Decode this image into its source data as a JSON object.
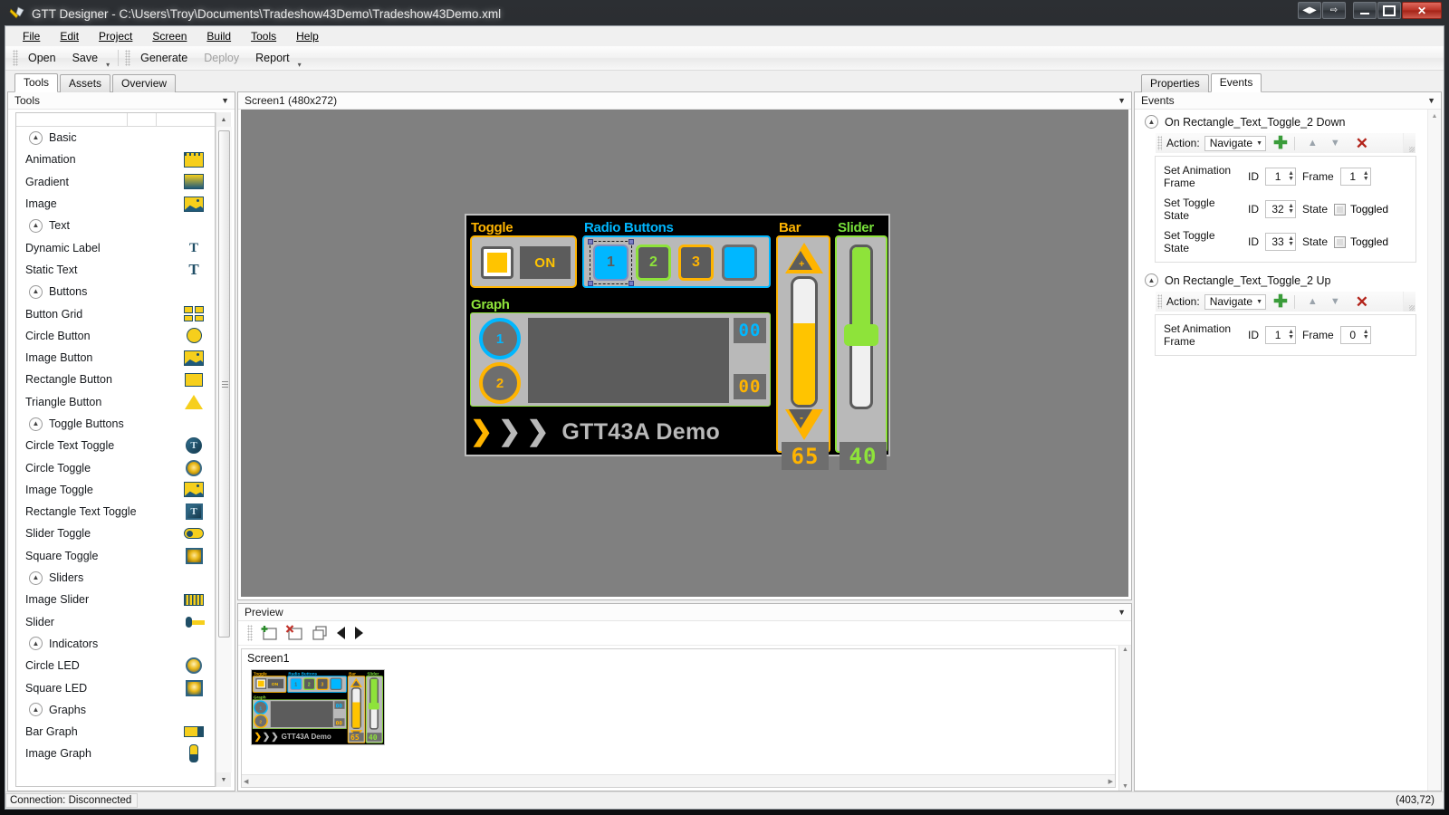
{
  "window": {
    "title": "GTT Designer - C:\\Users\\Troy\\Documents\\Tradeshow43Demo\\Tradeshow43Demo.xml",
    "buttons": {
      "expand": "◀▶",
      "restore_down": "⇨",
      "minimize": "—",
      "maximize": "❐",
      "close": "✕"
    }
  },
  "menu": [
    "File",
    "Edit",
    "Project",
    "Screen",
    "Build",
    "Tools",
    "Help"
  ],
  "toolbar": {
    "group1": [
      "Open",
      "Save"
    ],
    "group2": [
      "Generate",
      "Deploy",
      "Report"
    ],
    "disabled": [
      "Deploy"
    ]
  },
  "left": {
    "tabs": [
      {
        "label": "Tools",
        "active": true
      },
      {
        "label": "Assets",
        "active": false
      },
      {
        "label": "Overview",
        "active": false
      }
    ],
    "panel_title": "Tools",
    "items": [
      {
        "label": "Basic",
        "type": "group",
        "icon": "collapse-chevron-icon"
      },
      {
        "label": "Animation",
        "type": "item",
        "icon": "animation-icon"
      },
      {
        "label": "Gradient",
        "type": "item",
        "icon": "gradient-icon"
      },
      {
        "label": "Image",
        "type": "item",
        "icon": "image-icon"
      },
      {
        "label": "Text",
        "type": "group",
        "icon": "collapse-chevron-icon"
      },
      {
        "label": "Dynamic Label",
        "type": "item",
        "icon": "dynamic-label-icon"
      },
      {
        "label": "Static Text",
        "type": "item",
        "icon": "static-text-icon"
      },
      {
        "label": "Buttons",
        "type": "group",
        "icon": "collapse-chevron-icon"
      },
      {
        "label": "Button Grid",
        "type": "item",
        "icon": "button-grid-icon"
      },
      {
        "label": "Circle Button",
        "type": "item",
        "icon": "circle-button-icon"
      },
      {
        "label": "Image Button",
        "type": "item",
        "icon": "image-button-icon"
      },
      {
        "label": "Rectangle Button",
        "type": "item",
        "icon": "rectangle-button-icon"
      },
      {
        "label": "Triangle Button",
        "type": "item",
        "icon": "triangle-button-icon"
      },
      {
        "label": "Toggle Buttons",
        "type": "group",
        "icon": "collapse-chevron-icon"
      },
      {
        "label": "Circle Text Toggle",
        "type": "item",
        "icon": "circle-text-toggle-icon"
      },
      {
        "label": "Circle Toggle",
        "type": "item",
        "icon": "circle-toggle-icon"
      },
      {
        "label": "Image Toggle",
        "type": "item",
        "icon": "image-toggle-icon"
      },
      {
        "label": "Rectangle Text Toggle",
        "type": "item",
        "icon": "rectangle-text-toggle-icon"
      },
      {
        "label": "Slider Toggle",
        "type": "item",
        "icon": "slider-toggle-icon"
      },
      {
        "label": "Square Toggle",
        "type": "item",
        "icon": "square-toggle-icon"
      },
      {
        "label": "Sliders",
        "type": "group",
        "icon": "collapse-chevron-icon"
      },
      {
        "label": "Image Slider",
        "type": "item",
        "icon": "image-slider-icon"
      },
      {
        "label": "Slider",
        "type": "item",
        "icon": "slider-icon"
      },
      {
        "label": "Indicators",
        "type": "group",
        "icon": "collapse-chevron-icon"
      },
      {
        "label": "Circle LED",
        "type": "item",
        "icon": "circle-led-icon"
      },
      {
        "label": "Square LED",
        "type": "item",
        "icon": "square-led-icon"
      },
      {
        "label": "Graphs",
        "type": "group",
        "icon": "collapse-chevron-icon"
      },
      {
        "label": "Bar Graph",
        "type": "item",
        "icon": "bar-graph-icon"
      },
      {
        "label": "Image Graph",
        "type": "item",
        "icon": "image-graph-icon"
      }
    ]
  },
  "canvas": {
    "title": "Screen1 (480x272)",
    "screen": {
      "labels": {
        "toggle": "Toggle",
        "radio_buttons": "Radio Buttons",
        "bar": "Bar",
        "slider": "Slider",
        "graph": "Graph"
      },
      "toggle": {
        "state_text": "ON"
      },
      "radio_buttons": [
        {
          "label": "1",
          "selected": true
        },
        {
          "label": "2",
          "selected": false
        },
        {
          "label": "3",
          "selected": false
        },
        {
          "label": "",
          "selected": false
        }
      ],
      "graph": {
        "series_buttons": [
          "1",
          "2"
        ],
        "readouts": [
          "00",
          "00"
        ]
      },
      "bar": {
        "value": "65",
        "increment": "+",
        "decrement": "-"
      },
      "slider": {
        "value": "40"
      },
      "footer": {
        "chevrons": [
          "❯",
          "❯",
          "❯"
        ],
        "title": "GTT43A Demo"
      }
    }
  },
  "preview": {
    "panel_title": "Preview",
    "toolbar_icons": [
      "add-screen-icon",
      "delete-screen-icon",
      "copy-screen-icon",
      "prev-screen-icon",
      "next-screen-icon"
    ],
    "screen_label": "Screen1"
  },
  "right": {
    "tabs": [
      {
        "label": "Properties",
        "active": false
      },
      {
        "label": "Events",
        "active": true
      }
    ],
    "panel_title": "Events",
    "groups": [
      {
        "title": "On Rectangle_Text_Toggle_2 Down",
        "action_label": "Action:",
        "action_value": "Navigate",
        "actions": [
          {
            "name": "Set Animation Frame",
            "f1_label": "ID",
            "f1_value": "1",
            "f2_label": "Frame",
            "f2_value": "1",
            "f2_type": "spin"
          },
          {
            "name": "Set Toggle State",
            "f1_label": "ID",
            "f1_value": "32",
            "f2_label": "State",
            "f2_value": "Toggled",
            "f2_type": "checkbox"
          },
          {
            "name": "Set Toggle State",
            "f1_label": "ID",
            "f1_value": "33",
            "f2_label": "State",
            "f2_value": "Toggled",
            "f2_type": "checkbox"
          }
        ]
      },
      {
        "title": "On Rectangle_Text_Toggle_2 Up",
        "action_label": "Action:",
        "action_value": "Navigate",
        "actions": [
          {
            "name": "Set Animation Frame",
            "f1_label": "ID",
            "f1_value": "1",
            "f2_label": "Frame",
            "f2_value": "0",
            "f2_type": "spin"
          }
        ]
      }
    ]
  },
  "status": {
    "connection": "Connection: Disconnected",
    "coordinates": "(403,72)"
  },
  "colors": {
    "amber": "#ffb400",
    "cyan": "#00b7ff",
    "green": "#8ee33a",
    "gray_panel": "#b9b9b9",
    "dark_gray": "#5c5c5c",
    "canvas_bg": "#808080"
  }
}
